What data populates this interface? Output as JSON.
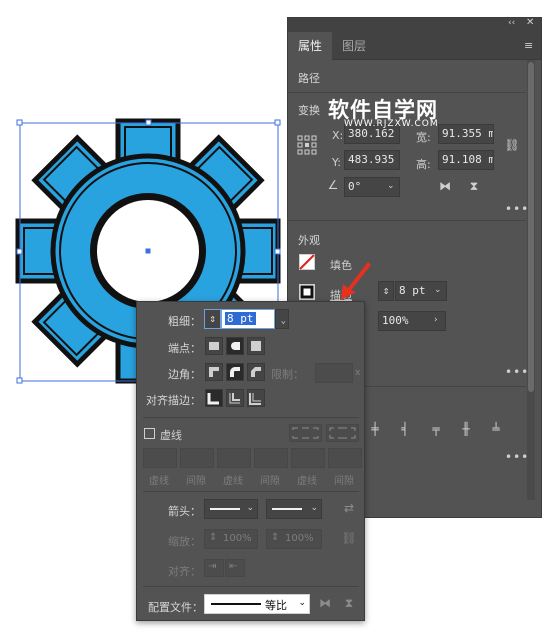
{
  "canvas": {
    "shape": "gear",
    "fill_color": "#29a3e0",
    "stroke_color": "#111111",
    "selection_color": "#3c6fe0"
  },
  "panel": {
    "collapse_icon": "double-chevron-icon",
    "close_icon": "close-icon",
    "menu_icon": "hamburger-icon",
    "tabs": [
      "属性",
      "图层"
    ],
    "section_path": "路径",
    "section_transform": "变换",
    "transform": {
      "x_label": "X:",
      "x_value": "380.162",
      "y_label": "Y:",
      "y_value": "483.935",
      "w_label": "宽:",
      "w_value": "91.355 m",
      "h_label": "高:",
      "h_value": "91.108 m",
      "angle_value": "0°"
    },
    "section_appearance": "外观",
    "fill_label": "填色",
    "stroke_label": "描边",
    "stroke_weight": "8 pt",
    "opacity_value": "100%",
    "more": "•••"
  },
  "watermark": {
    "title": "软件自学网",
    "url": "WWW.RJZXW.COM"
  },
  "stroke_popup": {
    "weight_label": "粗细：",
    "weight_value": "8 pt",
    "cap_label": "端点：",
    "corner_label": "边角：",
    "limit_label": "限制：",
    "limit_unit": "x",
    "align_label": "对齐描边：",
    "dashed_label": "虚线",
    "dash_labels": [
      "虚线",
      "间隙",
      "虚线",
      "间隙",
      "虚线",
      "间隙"
    ],
    "arrow_label": "箭头：",
    "scale_label": "缩放：",
    "scale_value_1": "100%",
    "scale_value_2": "100%",
    "align2_label": "对齐：",
    "profile_label": "配置文件：",
    "profile_value": "等比"
  }
}
